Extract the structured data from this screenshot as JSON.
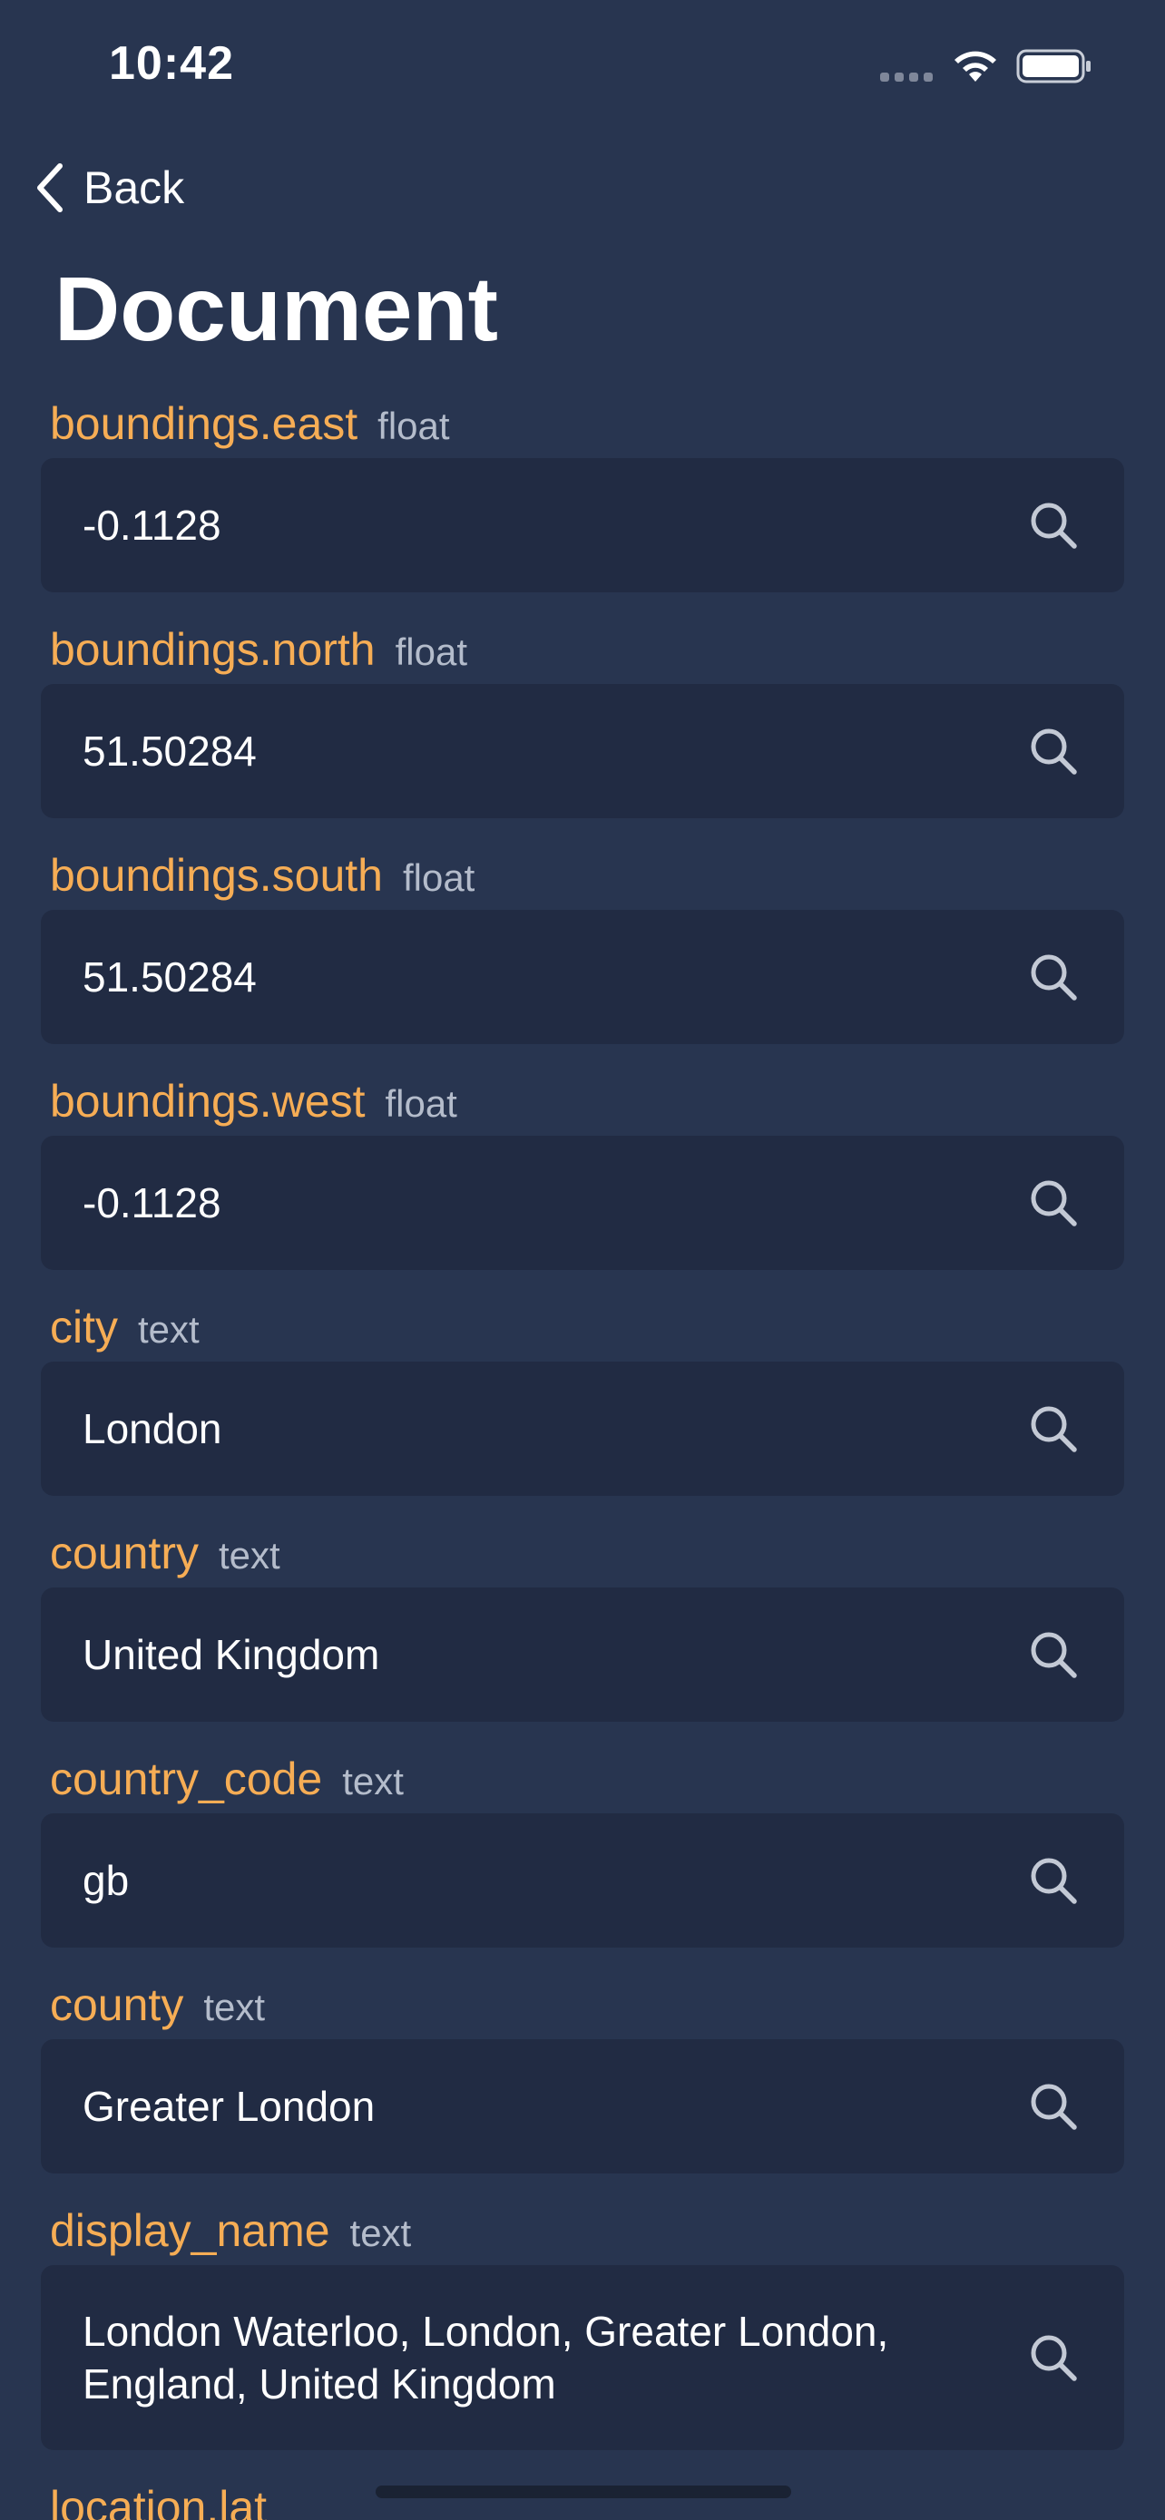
{
  "status_bar": {
    "time": "10:42"
  },
  "nav": {
    "back_label": "Back",
    "title": "Document"
  },
  "fields": [
    {
      "key": "boundings.east",
      "type": "float",
      "value": "-0.1128"
    },
    {
      "key": "boundings.north",
      "type": "float",
      "value": "51.50284"
    },
    {
      "key": "boundings.south",
      "type": "float",
      "value": "51.50284"
    },
    {
      "key": "boundings.west",
      "type": "float",
      "value": "-0.1128"
    },
    {
      "key": "city",
      "type": "text",
      "value": "London"
    },
    {
      "key": "country",
      "type": "text",
      "value": "United Kingdom"
    },
    {
      "key": "country_code",
      "type": "text",
      "value": "gb"
    },
    {
      "key": "county",
      "type": "text",
      "value": "Greater London"
    },
    {
      "key": "display_name",
      "type": "text",
      "value": "London Waterloo, London, Greater London, England, United Kingdom"
    },
    {
      "key": "location.lat",
      "type": "",
      "value": ""
    }
  ],
  "icons": {
    "back": "chevron-left-icon",
    "search": "search-icon",
    "wifi": "wifi-icon",
    "battery": "battery-icon",
    "signal": "signal-icon"
  },
  "colors": {
    "background": "#283550",
    "field_background": "#212b43",
    "key_accent": "#f6ad55",
    "type_label": "#b4bccb"
  }
}
